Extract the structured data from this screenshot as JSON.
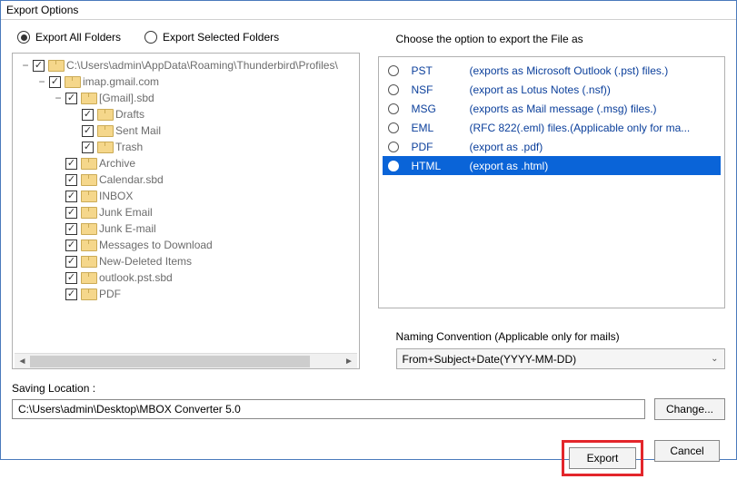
{
  "window": {
    "title": "Export Options"
  },
  "radios": {
    "export_all": "Export All Folders",
    "export_selected": "Export Selected Folders",
    "selected": "all"
  },
  "tree": {
    "root": "C:\\Users\\admin\\AppData\\Roaming\\Thunderbird\\Profiles\\",
    "nodes": [
      {
        "indent": 0,
        "toggle": "−",
        "label": "C:\\Users\\admin\\AppData\\Roaming\\Thunderbird\\Profiles\\"
      },
      {
        "indent": 1,
        "toggle": "−",
        "label": "imap.gmail.com"
      },
      {
        "indent": 2,
        "toggle": "−",
        "label": "[Gmail].sbd"
      },
      {
        "indent": 3,
        "toggle": "",
        "label": "Drafts"
      },
      {
        "indent": 3,
        "toggle": "",
        "label": "Sent Mail"
      },
      {
        "indent": 3,
        "toggle": "",
        "label": "Trash"
      },
      {
        "indent": 2,
        "toggle": "",
        "label": "Archive"
      },
      {
        "indent": 2,
        "toggle": "",
        "label": "Calendar.sbd"
      },
      {
        "indent": 2,
        "toggle": "",
        "label": "INBOX"
      },
      {
        "indent": 2,
        "toggle": "",
        "label": "Junk Email"
      },
      {
        "indent": 2,
        "toggle": "",
        "label": "Junk E-mail"
      },
      {
        "indent": 2,
        "toggle": "",
        "label": "Messages to Download"
      },
      {
        "indent": 2,
        "toggle": "",
        "label": "New-Deleted Items"
      },
      {
        "indent": 2,
        "toggle": "",
        "label": "outlook.pst.sbd"
      },
      {
        "indent": 2,
        "toggle": "",
        "label": "PDF"
      }
    ]
  },
  "formats": {
    "header": "Choose the option to export the File as",
    "items": [
      {
        "name": "PST",
        "desc": "(exports as Microsoft Outlook (.pst) files.)"
      },
      {
        "name": "NSF",
        "desc": "(export as Lotus Notes (.nsf))"
      },
      {
        "name": "MSG",
        "desc": "(exports as Mail message (.msg) files.)"
      },
      {
        "name": "EML",
        "desc": "(RFC 822(.eml) files.(Applicable only for ma..."
      },
      {
        "name": "PDF",
        "desc": "(export as .pdf)"
      },
      {
        "name": "HTML",
        "desc": "(export as .html)"
      }
    ],
    "selected_index": 5
  },
  "naming": {
    "label": "Naming Convention (Applicable only for mails)",
    "value": "From+Subject+Date(YYYY-MM-DD)"
  },
  "saving": {
    "label": "Saving Location :",
    "path": "C:\\Users\\admin\\Desktop\\MBOX Converter 5.0"
  },
  "buttons": {
    "change": "Change...",
    "export": "Export",
    "cancel": "Cancel"
  }
}
